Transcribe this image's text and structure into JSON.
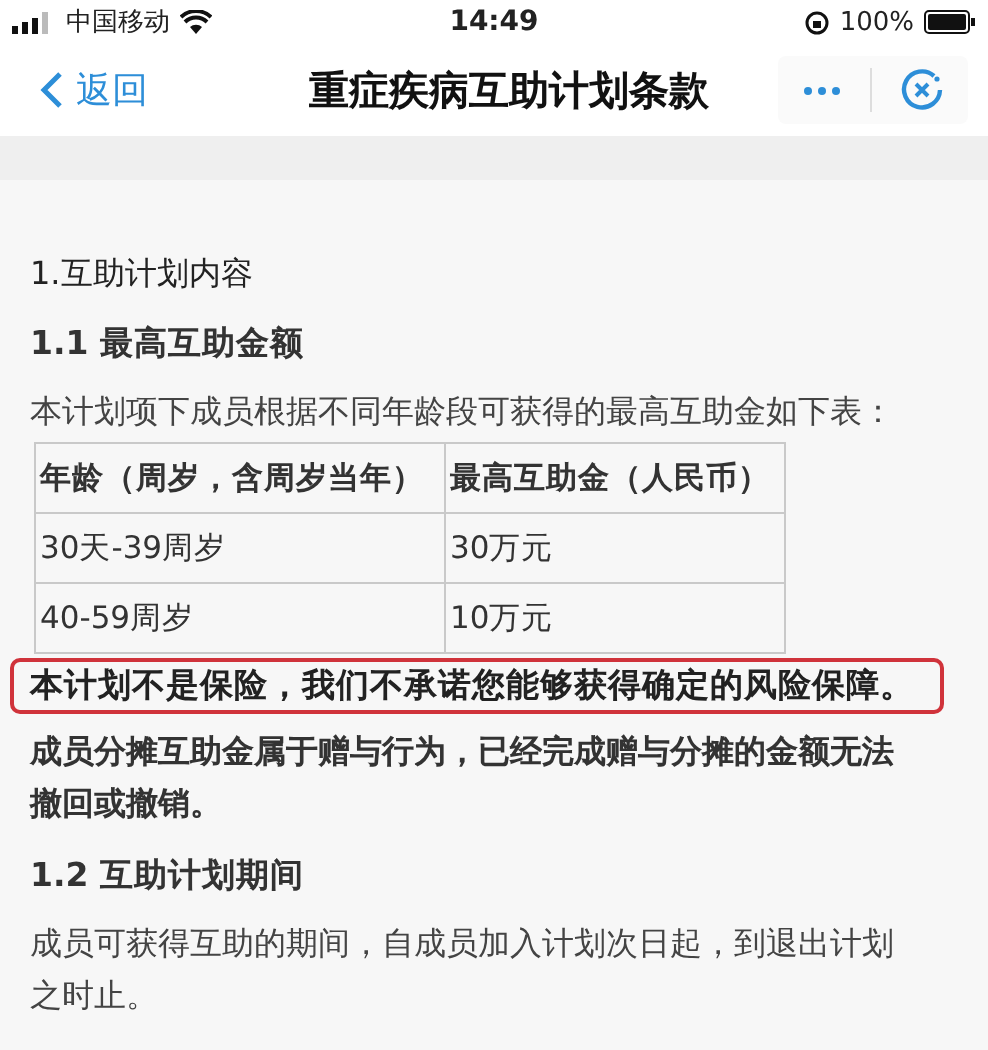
{
  "status_bar": {
    "carrier": "中国移动",
    "time": "14:49",
    "battery": "100%"
  },
  "nav_bar": {
    "back": "返回",
    "title": "重症疾病互助计划条款"
  },
  "content": [
    {
      "kind": "heading",
      "text": "1.互助计划内容"
    },
    {
      "kind": "subheading",
      "text": "1.1  最高互助金额"
    },
    {
      "kind": "paragraph",
      "text": "本计划项下成员根据不同年龄段可获得的最高互助金如下表："
    },
    {
      "kind": "table",
      "columns": [
        "年龄（周岁，含周岁当年）",
        "最高互助金（人民币）"
      ],
      "rows": [
        [
          "30天-39周岁",
          "30万元"
        ],
        [
          "40-59周岁",
          "10万元"
        ]
      ]
    },
    {
      "kind": "notice",
      "text": "本计划不是保险，我们不承诺您能够获得确定的风险保障。"
    },
    {
      "kind": "strong",
      "text": "成员分摊互助金属于赠与行为，已经完成赠与分摊的金额无法撤回或撤销。"
    },
    {
      "kind": "subheading",
      "text": "1.2  互助计划期间"
    },
    {
      "kind": "paragraph",
      "text": "成员可获得互助的期间，自成员加入计划次日起，到退出计划之时止。"
    }
  ]
}
